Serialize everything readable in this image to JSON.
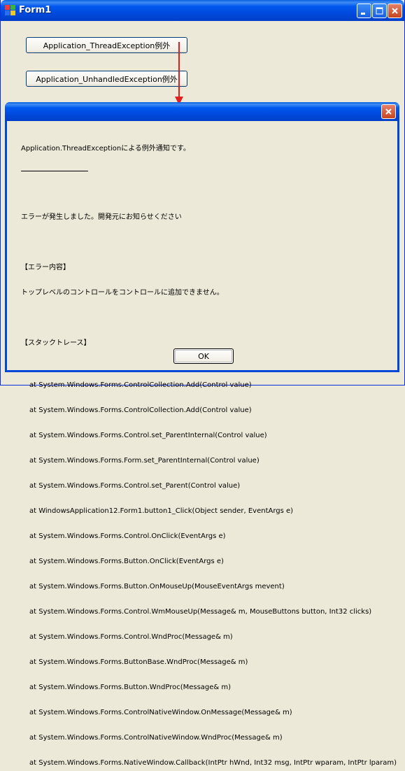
{
  "window": {
    "title": "Form1",
    "buttons": {
      "thread_exception": "Application_ThreadException例外",
      "unhandled_exception": "Application_UnhandledException例外"
    }
  },
  "dialog": {
    "heading": "Application.ThreadExceptionによる例外通知です。",
    "message": "エラーが発生しました。開発元にお知らせください",
    "error_header": "【エラー内容】",
    "error_text": "トップレベルのコントロールをコントロールに追加できません。",
    "trace_header": "【スタックトレース】",
    "trace": [
      "at System.Windows.Forms.ControlCollection.Add(Control value)",
      "at System.Windows.Forms.ControlCollection.Add(Control value)",
      "at System.Windows.Forms.Control.set_ParentInternal(Control value)",
      "at System.Windows.Forms.Form.set_ParentInternal(Control value)",
      "at System.Windows.Forms.Control.set_Parent(Control value)",
      "at WindowsApplication12.Form1.button1_Click(Object sender, EventArgs e)",
      "at System.Windows.Forms.Control.OnClick(EventArgs e)",
      "at System.Windows.Forms.Button.OnClick(EventArgs e)",
      "at System.Windows.Forms.Button.OnMouseUp(MouseEventArgs mevent)",
      "at System.Windows.Forms.Control.WmMouseUp(Message& m, MouseButtons button, Int32 clicks)",
      "at System.Windows.Forms.Control.WndProc(Message& m)",
      "at System.Windows.Forms.ButtonBase.WndProc(Message& m)",
      "at System.Windows.Forms.Button.WndProc(Message& m)",
      "at System.Windows.Forms.ControlNativeWindow.OnMessage(Message& m)",
      "at System.Windows.Forms.ControlNativeWindow.WndProc(Message& m)",
      "at System.Windows.Forms.NativeWindow.Callback(IntPtr hWnd, Int32 msg, IntPtr wparam, IntPtr lparam)"
    ],
    "ok_label": "OK"
  },
  "icons": {
    "app": "windows-form-icon",
    "minimize": "minimize-icon",
    "maximize": "maximize-icon",
    "close": "close-icon",
    "arrow": "red-arrow-icon"
  },
  "colors": {
    "titlebar": "#0047d9",
    "face": "#ece9d8",
    "close_button": "#c6451f",
    "arrow": "#e02020"
  }
}
